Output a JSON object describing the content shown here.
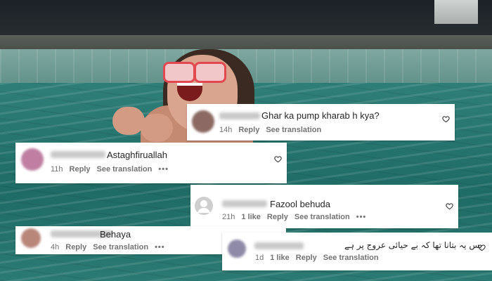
{
  "comments": [
    {
      "text": "Ghar ka pump kharab h kya?",
      "time": "14h",
      "reply": "Reply",
      "see_translation": "See translation",
      "avatar_color": "#8c6a63",
      "icon": "heart-outline-icon"
    },
    {
      "text": "Astaghfiruallah",
      "time": "11h",
      "reply": "Reply",
      "see_translation": "See translation",
      "more": "•••",
      "avatar_color": "#c07fa2",
      "icon": "heart-outline-icon"
    },
    {
      "text": "Fazool behuda",
      "time": "21h",
      "likes": "1 like",
      "reply": "Reply",
      "see_translation": "See translation",
      "more": "•••",
      "avatar_color": "#cfcfcf",
      "icon": "heart-outline-icon"
    },
    {
      "text": "Behaya",
      "time": "4h",
      "reply": "Reply",
      "see_translation": "See translation",
      "more": "•••",
      "avatar_color": "#b9867a",
      "icon": "heart-outline-icon"
    },
    {
      "text": "بس یہ بتانا تھا کہ بے حیائی عروج پر ہے",
      "time": "1d",
      "likes": "1 like",
      "reply": "Reply",
      "see_translation": "See translation",
      "avatar_color": "#8f8aa8",
      "icon": "heart-outline-icon"
    }
  ]
}
